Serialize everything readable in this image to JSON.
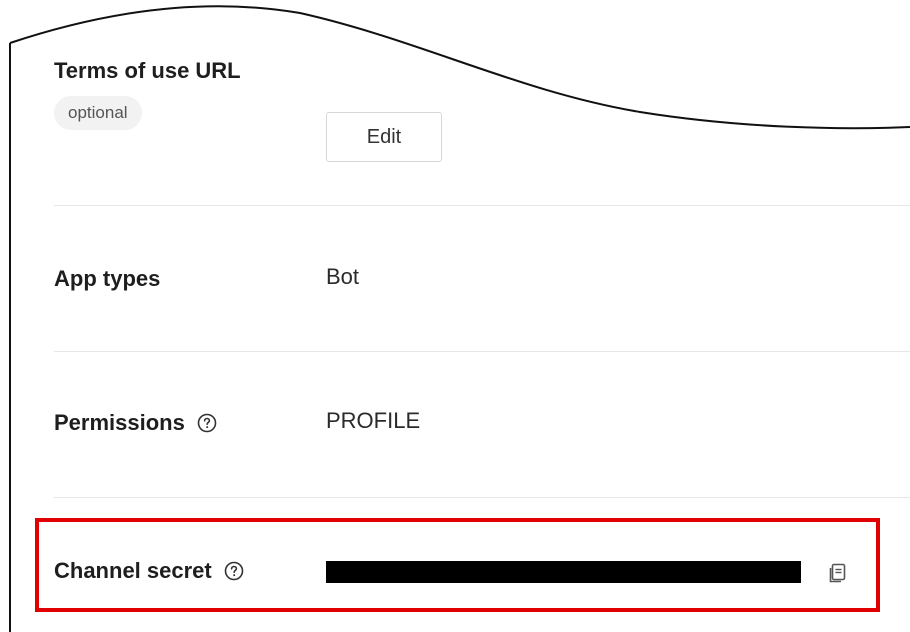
{
  "fields": {
    "terms_of_use": {
      "label": "Terms of use URL",
      "badge": "optional",
      "action_label": "Edit"
    },
    "app_types": {
      "label": "App types",
      "value": "Bot"
    },
    "permissions": {
      "label": "Permissions",
      "value": "PROFILE",
      "help_icon": "help-circle-icon"
    },
    "channel_secret": {
      "label": "Channel secret",
      "help_icon": "help-circle-icon",
      "copy_icon": "copy-icon",
      "value_state": "redacted"
    }
  },
  "colors": {
    "highlight": "#e00000",
    "divider": "#e6e6e6",
    "badge_bg": "#f2f2f2",
    "text": "#1e1e1e"
  }
}
